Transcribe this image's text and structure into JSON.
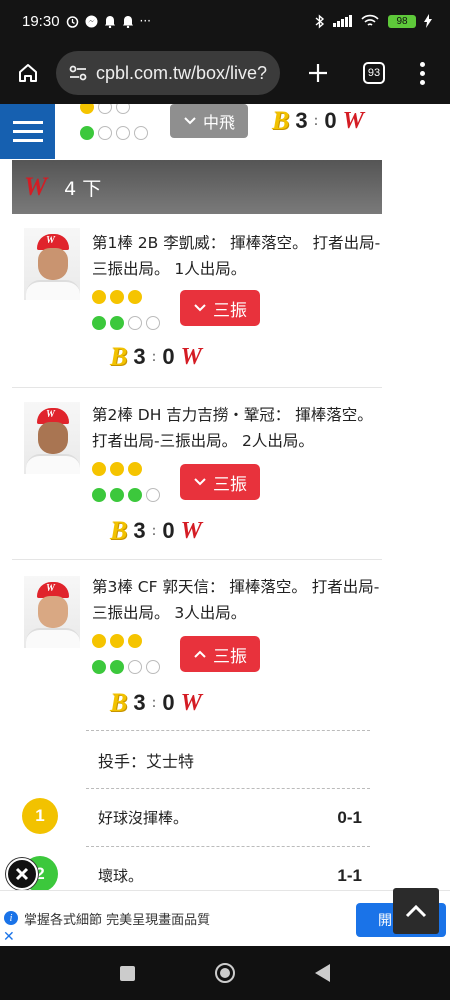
{
  "status_bar": {
    "time": "19:30",
    "icons": [
      "alarm-icon",
      "messenger-icon",
      "notification-icon",
      "notification-icon",
      "more-icon"
    ],
    "more": "···",
    "battery": "98"
  },
  "browser": {
    "url": "cpbl.com.tw/box/live?",
    "tab_count": "93"
  },
  "top_play": {
    "outs_balls_row1": [
      "yellow",
      "empty",
      "empty"
    ],
    "outs_balls_row2": [
      "green",
      "empty",
      "empty",
      "empty"
    ],
    "result_label": "中飛",
    "score_home": "3",
    "score_away": "0",
    "colon": ":"
  },
  "inning": {
    "team_logo": "W",
    "label": "4 下"
  },
  "plate_appearances": [
    {
      "description": "第1棒 2B 李凱威： 揮棒落空。 打者出局-三振出局。 1人出局。",
      "strikes": [
        "yellow",
        "yellow",
        "yellow"
      ],
      "balls": [
        "green",
        "green",
        "empty",
        "empty"
      ],
      "result_label": "三振",
      "expanded": false,
      "score_home": "3",
      "score_away": "0"
    },
    {
      "description": "第2棒 DH 吉力吉撈・鞏冠： 揮棒落空。 打者出局-三振出局。 2人出局。",
      "strikes": [
        "yellow",
        "yellow",
        "yellow"
      ],
      "balls": [
        "green",
        "green",
        "green",
        "empty"
      ],
      "result_label": "三振",
      "expanded": false,
      "score_home": "3",
      "score_away": "0"
    },
    {
      "description": "第3棒 CF 郭天信： 揮棒落空。 打者出局-三振出局。 3人出局。",
      "strikes": [
        "yellow",
        "yellow",
        "yellow"
      ],
      "balls": [
        "green",
        "green",
        "empty",
        "empty"
      ],
      "result_label": "三振",
      "expanded": true,
      "score_home": "3",
      "score_away": "0"
    }
  ],
  "pitch_detail": {
    "pitcher_label": "投手：艾士特",
    "pitches": [
      {
        "number": "1",
        "color": "#f2c200",
        "text": "好球沒揮棒。",
        "count": "0-1"
      },
      {
        "number": "2",
        "color": "#3cc83c",
        "text": "壞球。",
        "count": "1-1"
      }
    ]
  },
  "ad": {
    "text": "掌握各式細節 完美呈現畫面品質",
    "button": "開"
  },
  "colors": {
    "brand_blue": "#1660b0",
    "strike_red": "#e8323c",
    "brothers_yellow": "#f2c200",
    "wei_red": "#d41c24"
  }
}
